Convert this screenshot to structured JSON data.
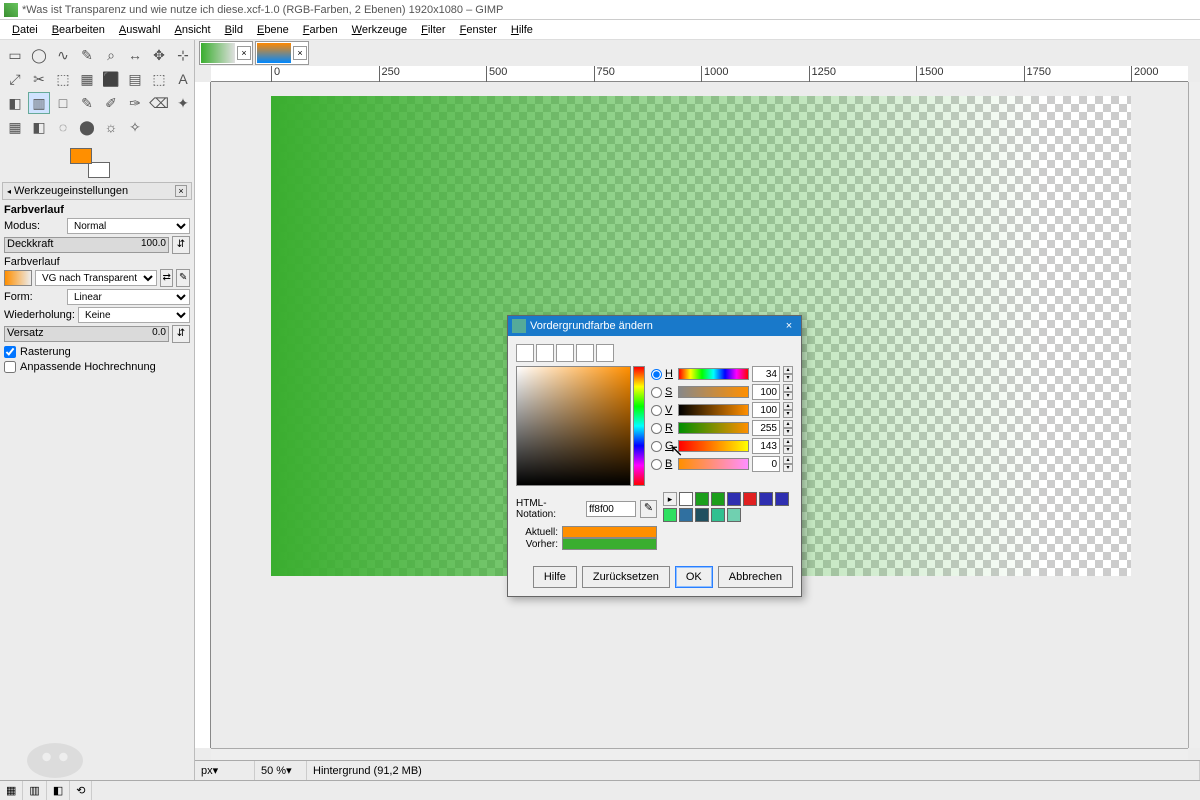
{
  "window": {
    "title": "*Was ist Transparenz und wie nutze ich diese.xcf-1.0 (RGB-Farben, 2 Ebenen) 1920x1080 – GIMP"
  },
  "menu": [
    "Datei",
    "Bearbeiten",
    "Auswahl",
    "Ansicht",
    "Bild",
    "Ebene",
    "Farben",
    "Werkzeuge",
    "Filter",
    "Fenster",
    "Hilfe"
  ],
  "toolbox_icons": [
    "▭",
    "◯",
    "∿",
    "✎",
    "⌕",
    "↔",
    "✥",
    "⊹",
    "⤢",
    "✂",
    "⬚",
    "▦",
    "⬛",
    "▤",
    "⬚",
    "A",
    "◧",
    "▥",
    "□",
    "✎",
    "✐",
    "✑",
    "⌫",
    "✦",
    "▦",
    "◧",
    "◌",
    "⬤",
    "☼",
    "✧"
  ],
  "fgbg": {
    "fg": "#ff8f00",
    "bg": "#ffffff"
  },
  "tool_options_title": "Werkzeugeinstellungen",
  "opts": {
    "section": "Farbverlauf",
    "mode_label": "Modus:",
    "mode_value": "Normal",
    "opacity_label": "Deckkraft",
    "opacity_value": "100.0",
    "gradient_label": "Farbverlauf",
    "gradient_value": "VG nach Transparent",
    "shape_label": "Form:",
    "shape_value": "Linear",
    "repeat_label": "Wiederholung:",
    "repeat_value": "Keine",
    "offset_label": "Versatz",
    "offset_value": "0.0",
    "dither_label": "Rasterung",
    "adaptive_label": "Anpassende Hochrechnung"
  },
  "ruler_ticks": [
    0,
    250,
    500,
    750,
    1000,
    1250,
    1500,
    1750,
    2000
  ],
  "status": {
    "unit": "px",
    "zoom": "50 %",
    "layer": "Hintergrund (91,2 MB)"
  },
  "dialog": {
    "title": "Vordergrundfarbe ändern",
    "channels": [
      {
        "k": "H",
        "v": "34",
        "cls": "hg",
        "sel": true
      },
      {
        "k": "S",
        "v": "100",
        "cls": "sg",
        "sel": false
      },
      {
        "k": "V",
        "v": "100",
        "cls": "vg",
        "sel": false
      },
      {
        "k": "R",
        "v": "255",
        "cls": "rg",
        "sel": false
      },
      {
        "k": "G",
        "v": "143",
        "cls": "gg",
        "sel": false
      },
      {
        "k": "B",
        "v": "0",
        "cls": "bg2",
        "sel": false
      }
    ],
    "html_label": "HTML-Notation:",
    "html_value": "ff8f00",
    "current_label": "Aktuell:",
    "prev_label": "Vorher:",
    "current_color": "#ff8f00",
    "prev_color": "#3aae2f",
    "swatches": [
      "#ffffff",
      "#1b9e1b",
      "#1b9e1b",
      "#2f2fb0",
      "#e02020",
      "#2f2fb0",
      "#2f2fb0",
      "#2fe060",
      "#3070a0",
      "#205060",
      "#30c090",
      "#70d0b0"
    ],
    "buttons": {
      "help": "Hilfe",
      "reset": "Zurücksetzen",
      "ok": "OK",
      "cancel": "Abbrechen"
    }
  }
}
